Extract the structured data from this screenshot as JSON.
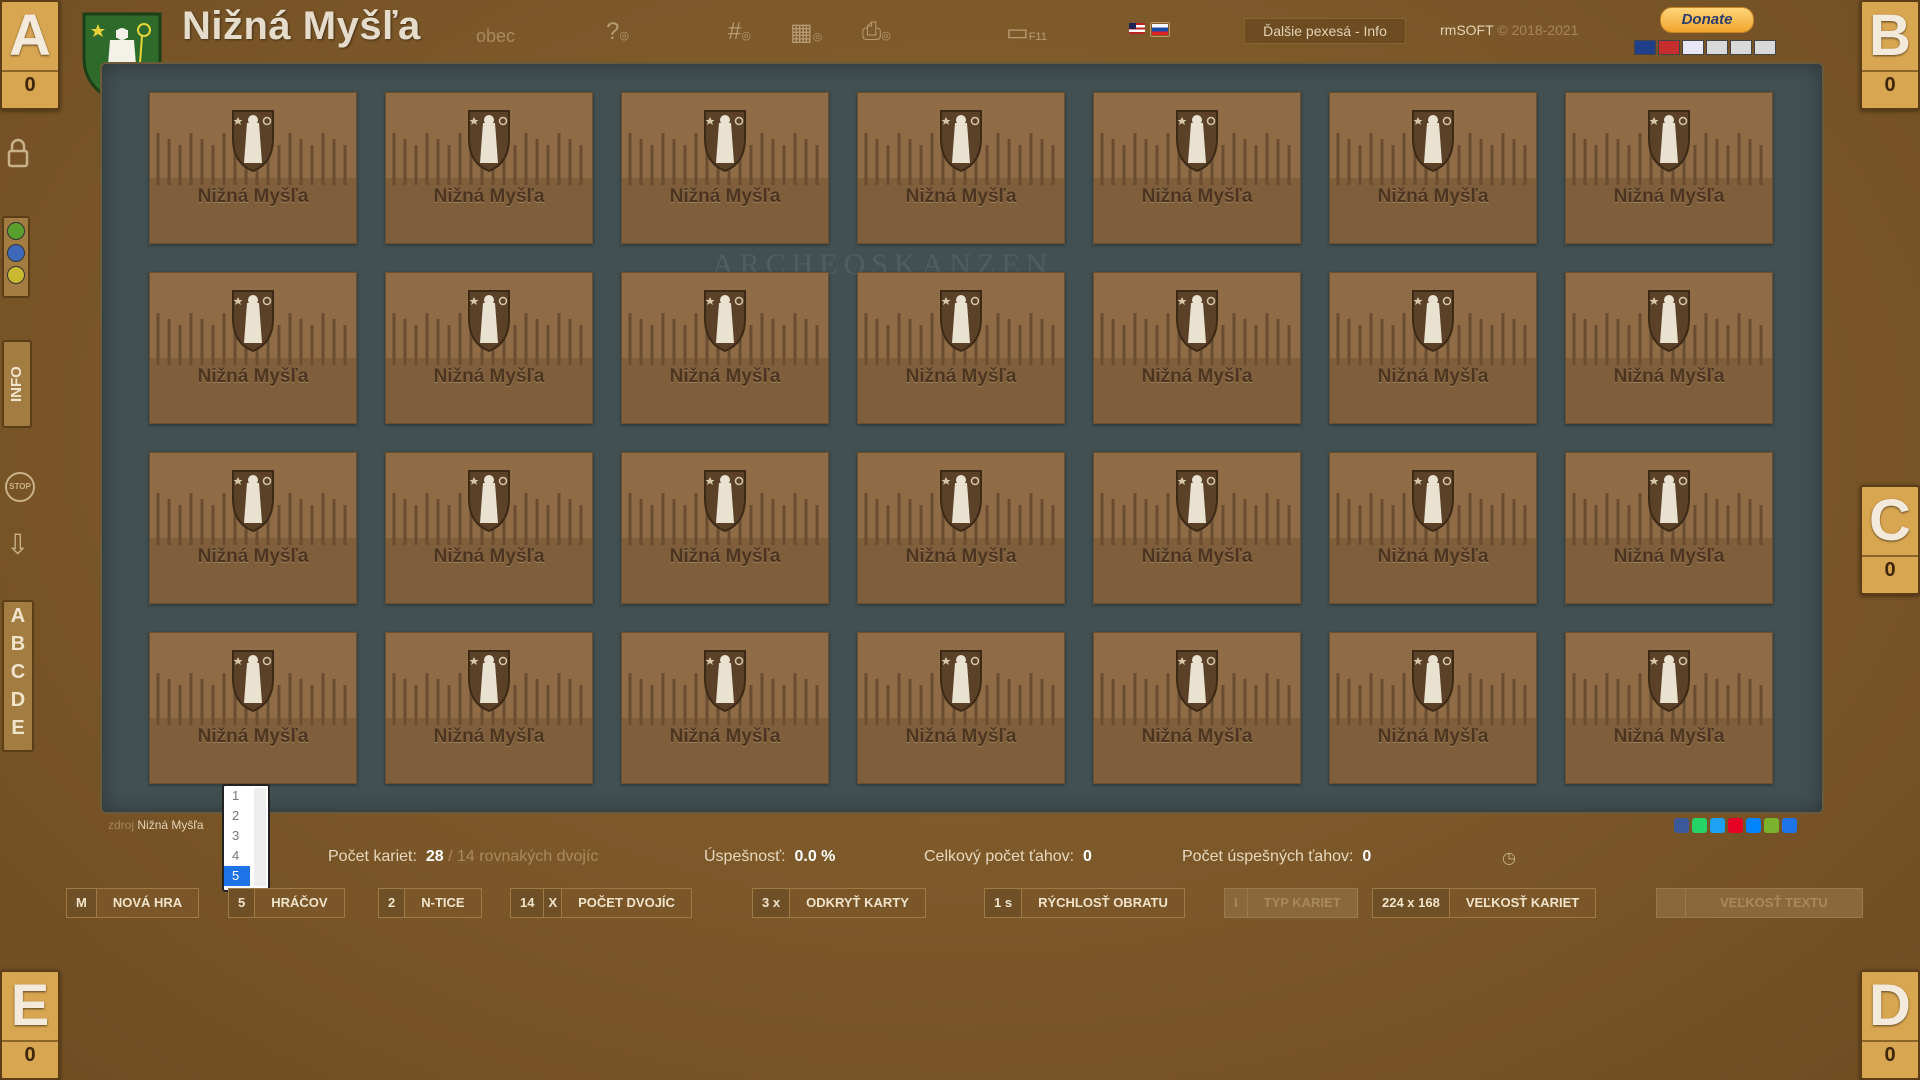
{
  "app": {
    "title": "Nižná Myšľa",
    "subtitle": "obec",
    "more_link": "Ďalšie pexesá - Info",
    "copyright_brand": "rmSOFT",
    "copyright_years": "© 2018-2021",
    "donate_label": "Donate",
    "fullscreen_key": "F11"
  },
  "players": [
    {
      "letter": "A",
      "score": "0"
    },
    {
      "letter": "B",
      "score": "0"
    },
    {
      "letter": "C",
      "score": "0"
    },
    {
      "letter": "D",
      "score": "0"
    },
    {
      "letter": "E",
      "score": "0"
    }
  ],
  "sidebar": {
    "info_label": "INFO",
    "stop_label": "STOP",
    "letters": [
      "A",
      "B",
      "C",
      "D",
      "E"
    ],
    "colors": [
      "#5a9e2e",
      "#3f69b8",
      "#c9b930"
    ]
  },
  "board": {
    "watermark": "ARCHEOSKANZEN",
    "card_label": "Nižná Myšľa",
    "rows": 4,
    "cols": 7
  },
  "source": {
    "prefix": "zdroj",
    "name": "Nižná Myšľa"
  },
  "players_dropdown": {
    "options": [
      "1",
      "2",
      "3",
      "4",
      "5"
    ],
    "selected": "5"
  },
  "stats": {
    "cards_label": "Počet kariet:",
    "cards_total": "28",
    "pairs_sep": "/",
    "pairs_count": "14",
    "pairs_label": "rovnakých dvojíc",
    "success_label": "Úspešnosť:",
    "success_value": "0.0 %",
    "moves_label": "Celkový počet ťahov:",
    "moves_value": "0",
    "good_moves_label": "Počet úspešných ťahov:",
    "good_moves_value": "0"
  },
  "controls": {
    "new_game": {
      "key": "M",
      "label": "NOVÁ HRA"
    },
    "players": {
      "value": "5",
      "label": "HRÁČOV"
    },
    "ntice": {
      "value": "2",
      "label": "N-TICE"
    },
    "pairs": {
      "value": "14",
      "x": "X",
      "label": "POČET DVOJÍC"
    },
    "reveal": {
      "value": "3 x",
      "label": "ODKRYŤ KARTY"
    },
    "speed": {
      "value": "1 s",
      "label": "RÝCHLOSŤ OBRATU"
    },
    "type": {
      "value": "I",
      "label": "TYP KARIET"
    },
    "card_size": {
      "value": "224 x 168",
      "label": "VEĽKOSŤ KARIET"
    },
    "text_size": {
      "value": "",
      "label": "VEĽKOSŤ TEXTU"
    }
  },
  "social_colors": [
    "#3b5998",
    "#25d366",
    "#1da1f2",
    "#e60023",
    "#0084ff",
    "#7bb32e",
    "#1e73e8"
  ]
}
